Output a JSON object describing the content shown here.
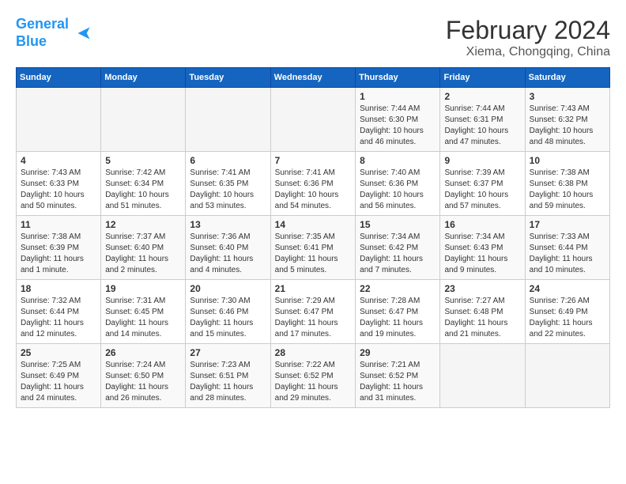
{
  "header": {
    "logo_line1": "General",
    "logo_line2": "Blue",
    "month_title": "February 2024",
    "subtitle": "Xiema, Chongqing, China"
  },
  "calendar": {
    "days_of_week": [
      "Sunday",
      "Monday",
      "Tuesday",
      "Wednesday",
      "Thursday",
      "Friday",
      "Saturday"
    ],
    "weeks": [
      [
        {
          "day": "",
          "info": ""
        },
        {
          "day": "",
          "info": ""
        },
        {
          "day": "",
          "info": ""
        },
        {
          "day": "",
          "info": ""
        },
        {
          "day": "1",
          "info": "Sunrise: 7:44 AM\nSunset: 6:30 PM\nDaylight: 10 hours\nand 46 minutes."
        },
        {
          "day": "2",
          "info": "Sunrise: 7:44 AM\nSunset: 6:31 PM\nDaylight: 10 hours\nand 47 minutes."
        },
        {
          "day": "3",
          "info": "Sunrise: 7:43 AM\nSunset: 6:32 PM\nDaylight: 10 hours\nand 48 minutes."
        }
      ],
      [
        {
          "day": "4",
          "info": "Sunrise: 7:43 AM\nSunset: 6:33 PM\nDaylight: 10 hours\nand 50 minutes."
        },
        {
          "day": "5",
          "info": "Sunrise: 7:42 AM\nSunset: 6:34 PM\nDaylight: 10 hours\nand 51 minutes."
        },
        {
          "day": "6",
          "info": "Sunrise: 7:41 AM\nSunset: 6:35 PM\nDaylight: 10 hours\nand 53 minutes."
        },
        {
          "day": "7",
          "info": "Sunrise: 7:41 AM\nSunset: 6:36 PM\nDaylight: 10 hours\nand 54 minutes."
        },
        {
          "day": "8",
          "info": "Sunrise: 7:40 AM\nSunset: 6:36 PM\nDaylight: 10 hours\nand 56 minutes."
        },
        {
          "day": "9",
          "info": "Sunrise: 7:39 AM\nSunset: 6:37 PM\nDaylight: 10 hours\nand 57 minutes."
        },
        {
          "day": "10",
          "info": "Sunrise: 7:38 AM\nSunset: 6:38 PM\nDaylight: 10 hours\nand 59 minutes."
        }
      ],
      [
        {
          "day": "11",
          "info": "Sunrise: 7:38 AM\nSunset: 6:39 PM\nDaylight: 11 hours\nand 1 minute."
        },
        {
          "day": "12",
          "info": "Sunrise: 7:37 AM\nSunset: 6:40 PM\nDaylight: 11 hours\nand 2 minutes."
        },
        {
          "day": "13",
          "info": "Sunrise: 7:36 AM\nSunset: 6:40 PM\nDaylight: 11 hours\nand 4 minutes."
        },
        {
          "day": "14",
          "info": "Sunrise: 7:35 AM\nSunset: 6:41 PM\nDaylight: 11 hours\nand 5 minutes."
        },
        {
          "day": "15",
          "info": "Sunrise: 7:34 AM\nSunset: 6:42 PM\nDaylight: 11 hours\nand 7 minutes."
        },
        {
          "day": "16",
          "info": "Sunrise: 7:34 AM\nSunset: 6:43 PM\nDaylight: 11 hours\nand 9 minutes."
        },
        {
          "day": "17",
          "info": "Sunrise: 7:33 AM\nSunset: 6:44 PM\nDaylight: 11 hours\nand 10 minutes."
        }
      ],
      [
        {
          "day": "18",
          "info": "Sunrise: 7:32 AM\nSunset: 6:44 PM\nDaylight: 11 hours\nand 12 minutes."
        },
        {
          "day": "19",
          "info": "Sunrise: 7:31 AM\nSunset: 6:45 PM\nDaylight: 11 hours\nand 14 minutes."
        },
        {
          "day": "20",
          "info": "Sunrise: 7:30 AM\nSunset: 6:46 PM\nDaylight: 11 hours\nand 15 minutes."
        },
        {
          "day": "21",
          "info": "Sunrise: 7:29 AM\nSunset: 6:47 PM\nDaylight: 11 hours\nand 17 minutes."
        },
        {
          "day": "22",
          "info": "Sunrise: 7:28 AM\nSunset: 6:47 PM\nDaylight: 11 hours\nand 19 minutes."
        },
        {
          "day": "23",
          "info": "Sunrise: 7:27 AM\nSunset: 6:48 PM\nDaylight: 11 hours\nand 21 minutes."
        },
        {
          "day": "24",
          "info": "Sunrise: 7:26 AM\nSunset: 6:49 PM\nDaylight: 11 hours\nand 22 minutes."
        }
      ],
      [
        {
          "day": "25",
          "info": "Sunrise: 7:25 AM\nSunset: 6:49 PM\nDaylight: 11 hours\nand 24 minutes."
        },
        {
          "day": "26",
          "info": "Sunrise: 7:24 AM\nSunset: 6:50 PM\nDaylight: 11 hours\nand 26 minutes."
        },
        {
          "day": "27",
          "info": "Sunrise: 7:23 AM\nSunset: 6:51 PM\nDaylight: 11 hours\nand 28 minutes."
        },
        {
          "day": "28",
          "info": "Sunrise: 7:22 AM\nSunset: 6:52 PM\nDaylight: 11 hours\nand 29 minutes."
        },
        {
          "day": "29",
          "info": "Sunrise: 7:21 AM\nSunset: 6:52 PM\nDaylight: 11 hours\nand 31 minutes."
        },
        {
          "day": "",
          "info": ""
        },
        {
          "day": "",
          "info": ""
        }
      ]
    ]
  }
}
